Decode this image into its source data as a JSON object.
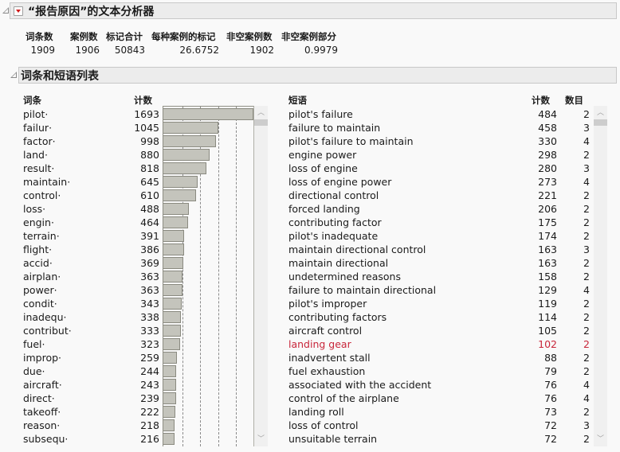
{
  "report": {
    "title": "“报告原因”的文本分析器",
    "menu_icon": "red-triangle-menu-icon"
  },
  "summary": {
    "headers": [
      "词条数",
      "案例数",
      "标记合计",
      "每种案例的标记",
      "非空案例数",
      "非空案例部分"
    ],
    "values": [
      "1909",
      "1906",
      "50843",
      "26.6752",
      "1902",
      "0.9979"
    ]
  },
  "section": {
    "title": "词条和短语列表"
  },
  "terms": {
    "header_term": "词条",
    "header_count": "计数",
    "rows": [
      {
        "term": "pilot·",
        "count": "1693"
      },
      {
        "term": "failur·",
        "count": "1045"
      },
      {
        "term": "factor·",
        "count": "998"
      },
      {
        "term": "land·",
        "count": "880"
      },
      {
        "term": "result·",
        "count": "818"
      },
      {
        "term": "maintain·",
        "count": "645"
      },
      {
        "term": "control·",
        "count": "610"
      },
      {
        "term": "loss·",
        "count": "488"
      },
      {
        "term": "engin·",
        "count": "464"
      },
      {
        "term": "terrain·",
        "count": "391"
      },
      {
        "term": "flight·",
        "count": "386"
      },
      {
        "term": "accid·",
        "count": "369"
      },
      {
        "term": "airplan·",
        "count": "363"
      },
      {
        "term": "power·",
        "count": "363"
      },
      {
        "term": "condit·",
        "count": "343"
      },
      {
        "term": "inadequ·",
        "count": "338"
      },
      {
        "term": "contribut·",
        "count": "333"
      },
      {
        "term": "fuel·",
        "count": "323"
      },
      {
        "term": "improp·",
        "count": "259"
      },
      {
        "term": "due·",
        "count": "244"
      },
      {
        "term": "aircraft·",
        "count": "243"
      },
      {
        "term": "direct·",
        "count": "239"
      },
      {
        "term": "takeoff·",
        "count": "222"
      },
      {
        "term": "reason·",
        "count": "218"
      },
      {
        "term": "subsequ·",
        "count": "216"
      }
    ]
  },
  "phrases": {
    "header_phrase": "短语",
    "header_count": "计数",
    "header_n": "数目",
    "highlight_color": "#c8263a",
    "rows": [
      {
        "phrase": "pilot's failure",
        "count": "484",
        "n": "2"
      },
      {
        "phrase": "failure to maintain",
        "count": "458",
        "n": "3"
      },
      {
        "phrase": "pilot's failure to maintain",
        "count": "330",
        "n": "4"
      },
      {
        "phrase": "engine power",
        "count": "298",
        "n": "2"
      },
      {
        "phrase": "loss of engine",
        "count": "280",
        "n": "3"
      },
      {
        "phrase": "loss of engine power",
        "count": "273",
        "n": "4"
      },
      {
        "phrase": "directional control",
        "count": "221",
        "n": "2"
      },
      {
        "phrase": "forced landing",
        "count": "206",
        "n": "2"
      },
      {
        "phrase": "contributing factor",
        "count": "175",
        "n": "2"
      },
      {
        "phrase": "pilot's inadequate",
        "count": "174",
        "n": "2"
      },
      {
        "phrase": "maintain directional control",
        "count": "163",
        "n": "3"
      },
      {
        "phrase": "maintain directional",
        "count": "163",
        "n": "2"
      },
      {
        "phrase": "undetermined reasons",
        "count": "158",
        "n": "2"
      },
      {
        "phrase": "failure to maintain directional",
        "count": "129",
        "n": "4"
      },
      {
        "phrase": "pilot's improper",
        "count": "119",
        "n": "2"
      },
      {
        "phrase": "contributing factors",
        "count": "114",
        "n": "2"
      },
      {
        "phrase": "aircraft control",
        "count": "105",
        "n": "2"
      },
      {
        "phrase": "landing gear",
        "count": "102",
        "n": "2",
        "highlighted": true
      },
      {
        "phrase": "inadvertent stall",
        "count": "88",
        "n": "2"
      },
      {
        "phrase": "fuel exhaustion",
        "count": "79",
        "n": "2"
      },
      {
        "phrase": "associated with the accident",
        "count": "76",
        "n": "4"
      },
      {
        "phrase": "control of the airplane",
        "count": "76",
        "n": "4"
      },
      {
        "phrase": "landing roll",
        "count": "73",
        "n": "2"
      },
      {
        "phrase": "loss of control",
        "count": "72",
        "n": "3"
      },
      {
        "phrase": "unsuitable terrain",
        "count": "72",
        "n": "2"
      }
    ]
  },
  "chart_data": {
    "type": "bar",
    "orientation": "horizontal",
    "title": "",
    "xlabel": "",
    "ylabel": "",
    "categories": [
      "pilot·",
      "failur·",
      "factor·",
      "land·",
      "result·",
      "maintain·",
      "control·",
      "loss·",
      "engin·",
      "terrain·",
      "flight·",
      "accid·",
      "airplan·",
      "power·",
      "condit·",
      "inadequ·",
      "contribut·",
      "fuel·",
      "improp·",
      "due·",
      "aircraft·",
      "direct·",
      "takeoff·",
      "reason·",
      "subsequ·"
    ],
    "values": [
      1693,
      1045,
      998,
      880,
      818,
      645,
      610,
      488,
      464,
      391,
      386,
      369,
      363,
      363,
      343,
      338,
      333,
      323,
      259,
      244,
      243,
      239,
      222,
      218,
      216
    ],
    "xlim": [
      0,
      1700
    ],
    "grid": true,
    "legend": "none"
  }
}
